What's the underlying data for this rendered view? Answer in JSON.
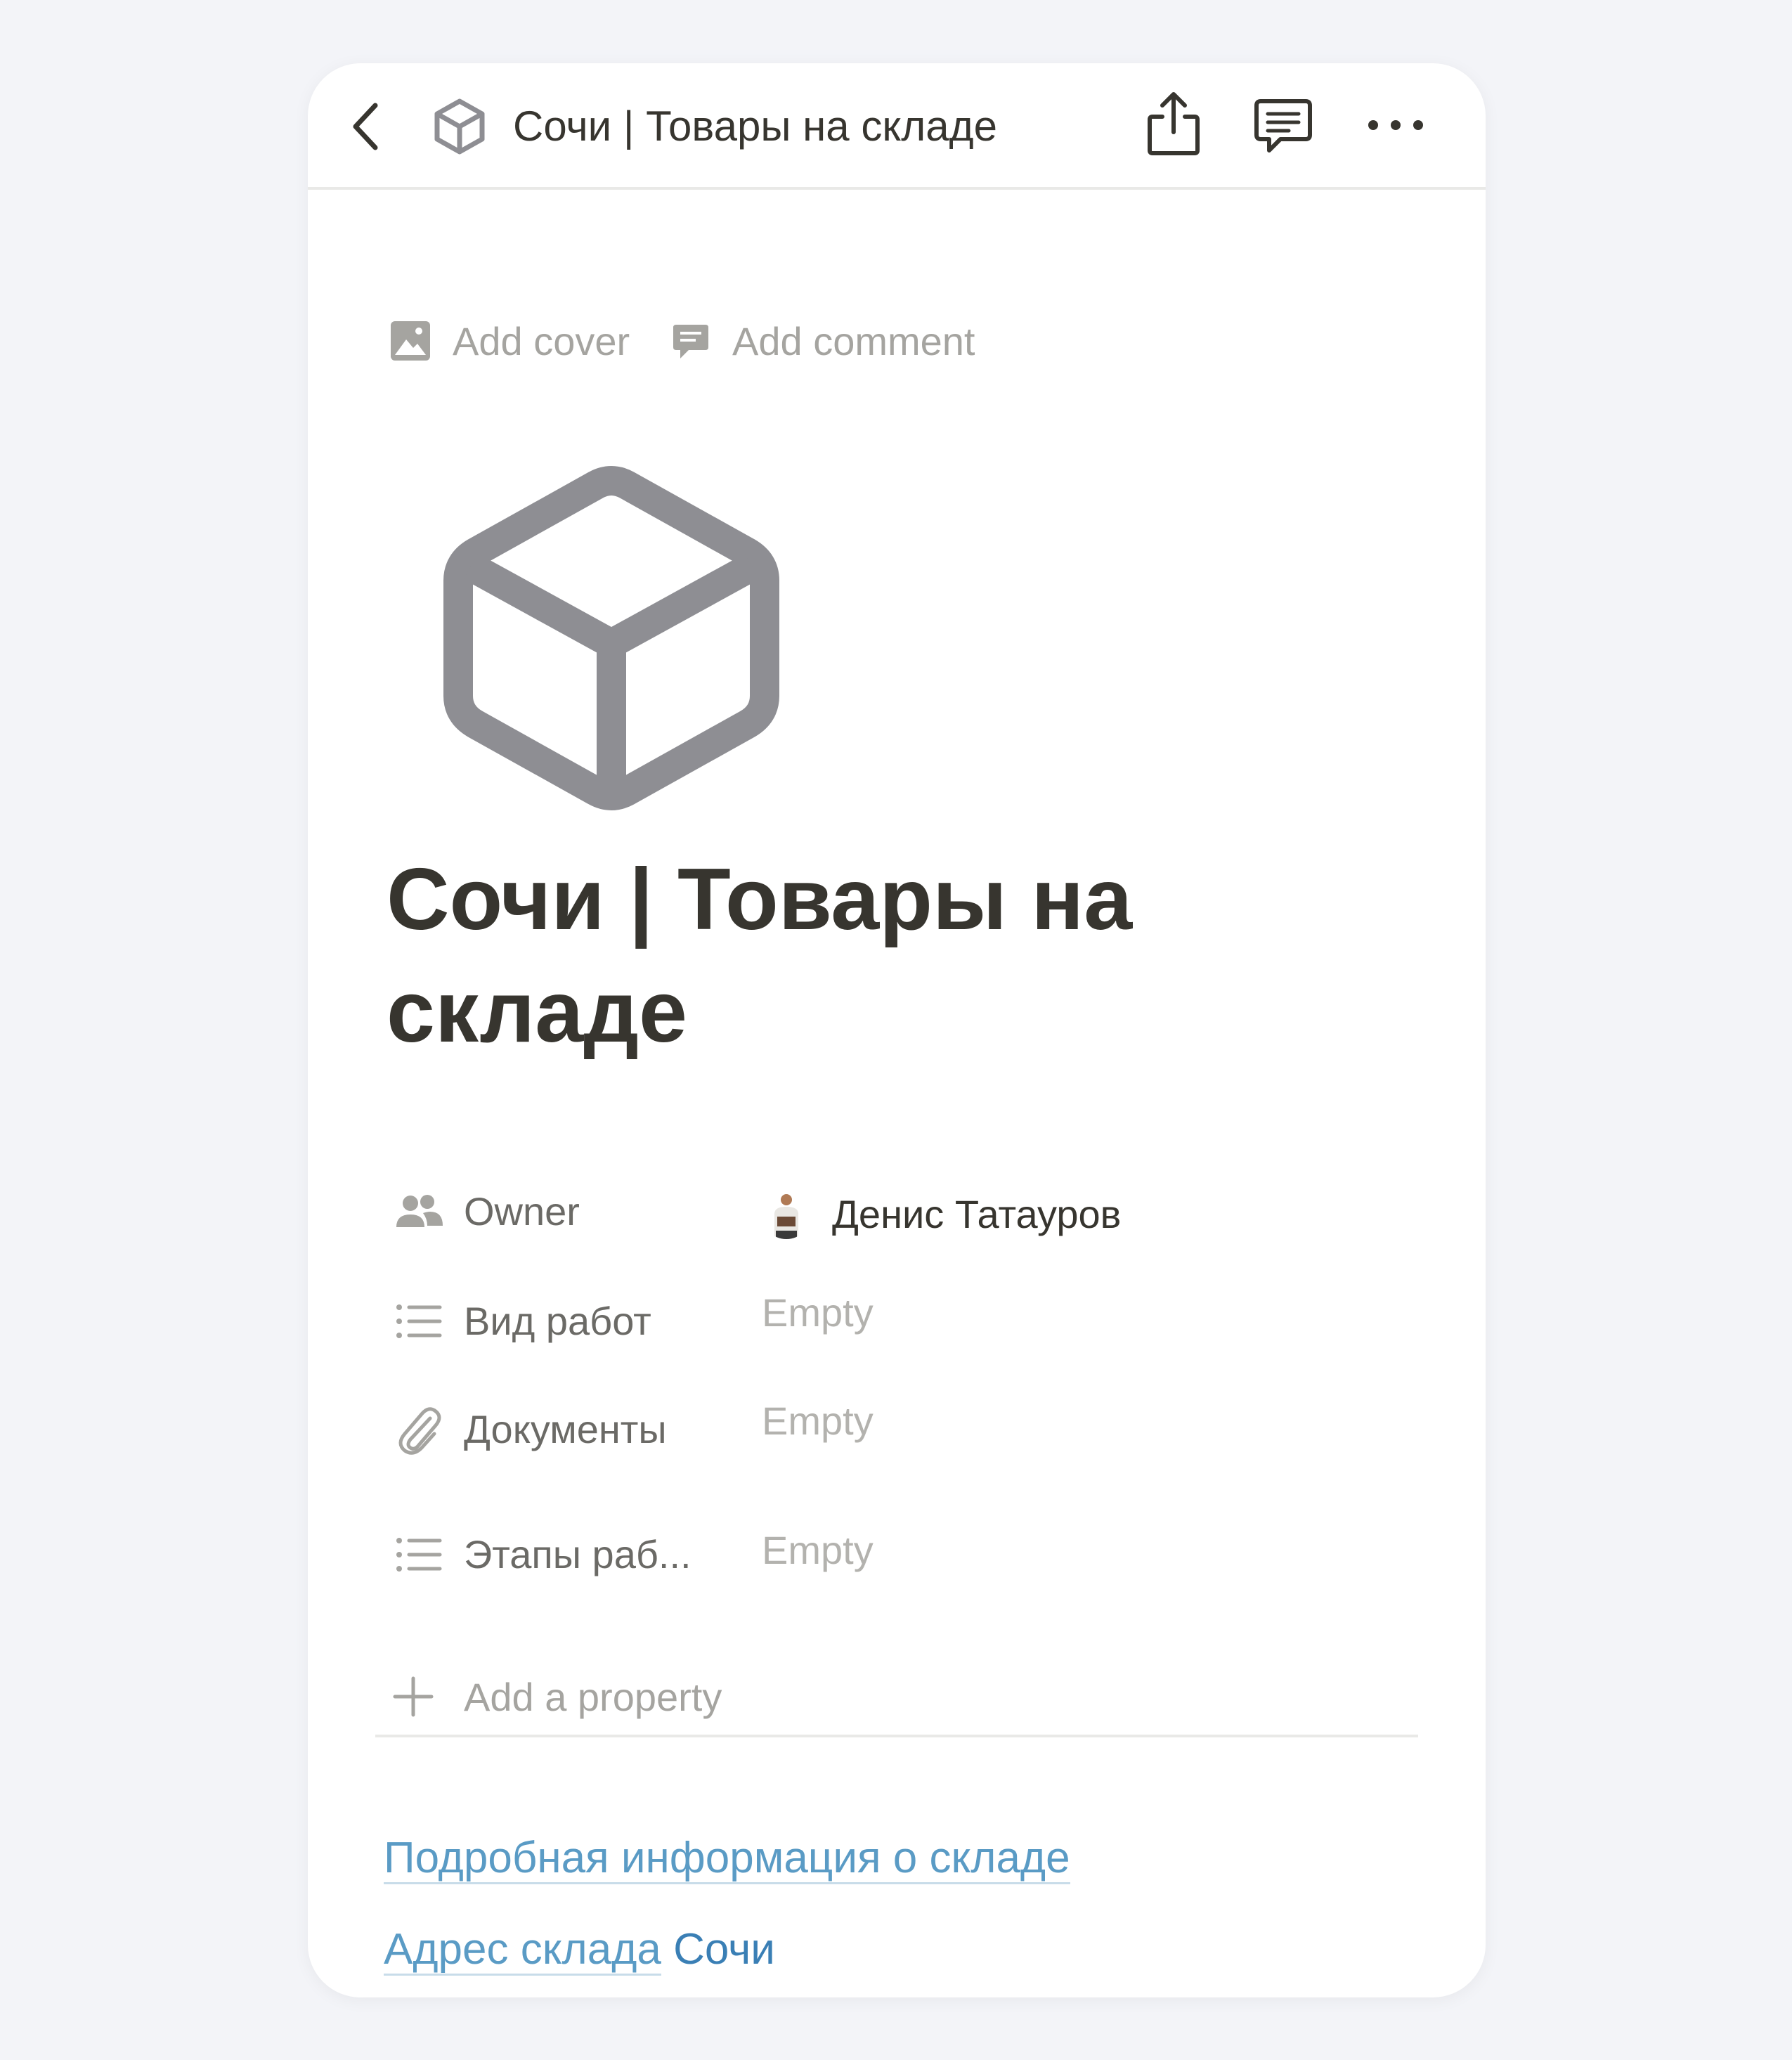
{
  "topbar": {
    "back_icon": "chevron-left-icon",
    "page_icon": "cube-icon",
    "title": "Сочи | Товары на складе",
    "share_icon": "share-icon",
    "comment_icon": "comment-icon",
    "more_icon": "more-horizontal-icon"
  },
  "meta": {
    "add_cover": "Add cover",
    "add_comment": "Add comment"
  },
  "page": {
    "icon": "cube-icon",
    "title": "Сочи | Товары на складе"
  },
  "properties": [
    {
      "icon": "people-icon",
      "name": "Owner",
      "value": "Денис Татауров",
      "type": "person"
    },
    {
      "icon": "list-icon",
      "name": "Вид работ",
      "value": "Empty",
      "type": "multi-select"
    },
    {
      "icon": "paperclip-icon",
      "name": "Документы",
      "value": "Empty",
      "type": "files"
    },
    {
      "icon": "list-icon",
      "name": "Этапы раб...",
      "value": "Empty",
      "type": "multi-select"
    }
  ],
  "add_property": "Add a property",
  "links": {
    "details": "Подробная информация о складе",
    "address_link": "Адрес склада",
    "address_text": " Сочи"
  },
  "colors": {
    "background": "#f3f4f8",
    "card": "#ffffff",
    "text": "#37352f",
    "muted": "#a5a4a0",
    "link": "#5a9bc5",
    "icon_gray": "#8e8e93"
  }
}
